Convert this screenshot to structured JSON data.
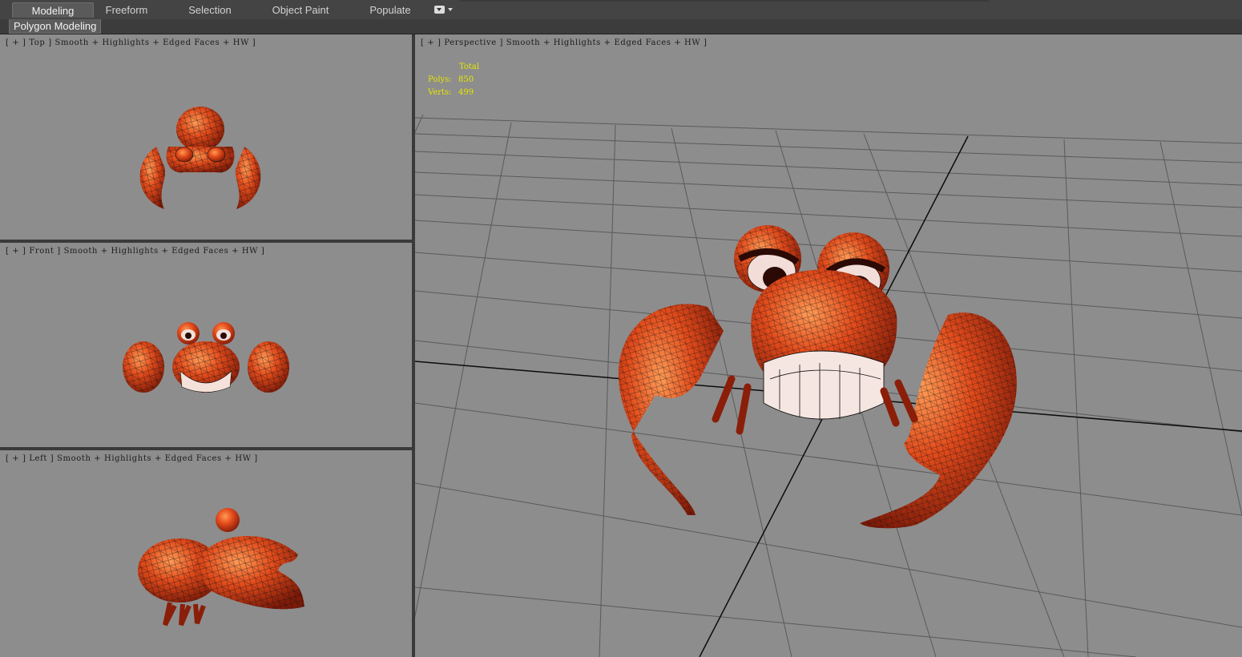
{
  "ribbon": {
    "tabs": [
      {
        "label": "Modeling",
        "active": true
      },
      {
        "label": "Freeform",
        "active": false
      },
      {
        "label": "Selection",
        "active": false
      },
      {
        "label": "Object Paint",
        "active": false
      },
      {
        "label": "Populate",
        "active": false
      }
    ]
  },
  "subbar": {
    "label": "Polygon Modeling"
  },
  "viewports": {
    "top": {
      "label": "[ + ] Top ] Smooth + Highlights + Edged Faces + HW ]"
    },
    "front": {
      "label": "[ + ] Front ] Smooth + Highlights + Edged Faces + HW ]"
    },
    "left": {
      "label": "[ + ] Left ] Smooth + Highlights + Edged Faces + HW ]"
    },
    "perspective": {
      "label": "[ + ] Perspective ] Smooth + Highlights + Edged Faces + HW ]",
      "stats": {
        "header": "Total",
        "polys_label": "Polys:",
        "polys": "850",
        "verts_label": "Verts:",
        "verts": "499"
      }
    }
  },
  "colors": {
    "viewport_bg": "#8d8d8d",
    "crab_shell": "#e04a1c",
    "stats_text": "#e6e600"
  },
  "icons": [
    "viewport-menu-icon",
    "crab-model-icon"
  ]
}
